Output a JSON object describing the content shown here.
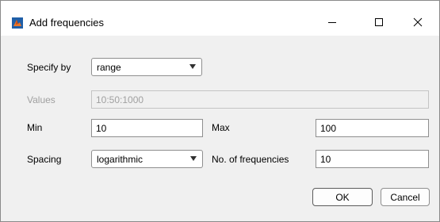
{
  "window": {
    "title": "Add frequencies",
    "icon": "matlab-icon",
    "controls": [
      "minimize-icon",
      "maximize-icon",
      "close-icon"
    ]
  },
  "form": {
    "specify_by": {
      "label": "Specify by",
      "value": "range"
    },
    "values": {
      "label": "Values",
      "value": "10:50:1000",
      "disabled": true
    },
    "min": {
      "label": "Min",
      "value": "10"
    },
    "max": {
      "label": "Max",
      "value": "100"
    },
    "spacing": {
      "label": "Spacing",
      "value": "logarithmic"
    },
    "num_frequencies": {
      "label": "No. of frequencies",
      "value": "10"
    }
  },
  "buttons": {
    "ok": "OK",
    "cancel": "Cancel"
  },
  "colors": {
    "window_bg": "#f0f0f0",
    "titlebar_bg": "#ffffff",
    "disabled_text": "#a0a0a0"
  }
}
